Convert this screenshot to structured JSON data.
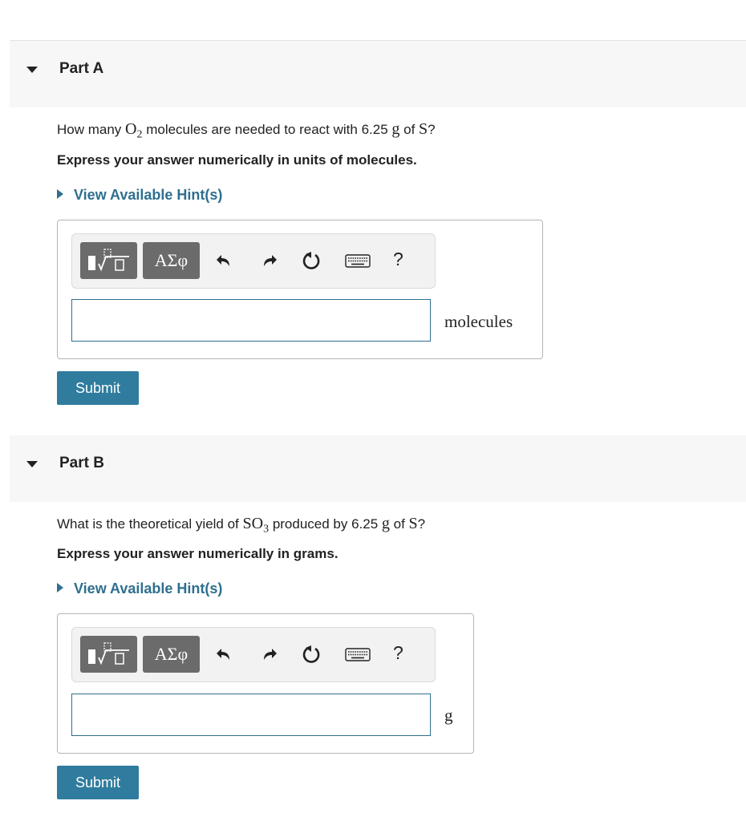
{
  "parts": [
    {
      "title": "Part A",
      "question": {
        "pre": "How many ",
        "chem": "O",
        "chem_sub": "2",
        "mid": " molecules are needed to react with 6.25 ",
        "unit_g": "g",
        "of": " of ",
        "element": "S",
        "end": "?"
      },
      "instruction": "Express your answer numerically in units of molecules.",
      "hint_label": "View Available Hint(s)",
      "toolbar": {
        "greek_label": "ΑΣφ",
        "help_label": "?"
      },
      "answer": {
        "value": "",
        "unit": "molecules"
      },
      "submit_label": "Submit"
    },
    {
      "title": "Part B",
      "question": {
        "pre": "What is the theoretical yield of ",
        "chem": "SO",
        "chem_sub": "3",
        "mid": " produced by 6.25 ",
        "unit_g": "g",
        "of": " of ",
        "element": "S",
        "end": "?"
      },
      "instruction": "Express your answer numerically in grams.",
      "hint_label": "View Available Hint(s)",
      "toolbar": {
        "greek_label": "ΑΣφ",
        "help_label": "?"
      },
      "answer": {
        "value": "",
        "unit": "g"
      },
      "submit_label": "Submit"
    }
  ],
  "icons": [
    "caret-down-icon",
    "hint-triangle-icon",
    "templates-icon",
    "undo-icon",
    "redo-icon",
    "reset-icon",
    "keyboard-icon"
  ],
  "colors": {
    "accent": "#2f7c9e",
    "link": "#2f6f8f",
    "header_bg": "#f7f7f7",
    "toolbar_button": "#6b6b6b"
  }
}
